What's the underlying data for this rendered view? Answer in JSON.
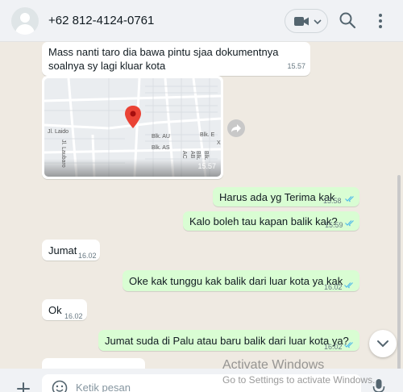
{
  "header": {
    "contact_name": "+62 812-4124-0761",
    "icons": [
      "avatar",
      "video-call-icon",
      "chevron-down-icon",
      "search-icon",
      "menu-icon"
    ]
  },
  "messages": [
    {
      "direction": "in",
      "text": "Mass nanti taro dia bawa pintu sjaa  dokumentnya soalnya sy lagi kluar kota",
      "time": "15.57"
    },
    {
      "direction": "in",
      "type": "location",
      "time": "15.57",
      "map_labels": [
        "Jl. Laido",
        "Jl. Laubaro",
        "Blk. AU",
        "Blk. AS",
        "Blk. E",
        "Blk. AC",
        "Blk. AB",
        "X"
      ]
    },
    {
      "direction": "out",
      "text": "Harus ada yg Terima kak",
      "time": "15.58",
      "status": "read"
    },
    {
      "direction": "out",
      "text": "Kalo boleh tau kapan balik kak?",
      "time": "15.59",
      "status": "read"
    },
    {
      "direction": "in",
      "text": "Jumat",
      "time": "16.02"
    },
    {
      "direction": "out",
      "text": "Oke kak tunggu kak balik dari luar kota ya kak",
      "time": "16.02",
      "status": "read"
    },
    {
      "direction": "in",
      "text": "Ok",
      "time": "16.02"
    },
    {
      "direction": "out",
      "text": "Jumat suda di Palu atau baru balik dari luar kota ya?",
      "time": "16.02",
      "status": "read"
    }
  ],
  "footer": {
    "placeholder": "Ketik pesan"
  },
  "watermark": {
    "line1": "Activate Windows",
    "line2": "Go to Settings to activate Windows."
  },
  "colors": {
    "chat_bg": "#efeae2",
    "outgoing": "#d9fdd3",
    "incoming": "#ffffff",
    "read_ticks": "#53bdeb",
    "pin": "#ea4335"
  }
}
